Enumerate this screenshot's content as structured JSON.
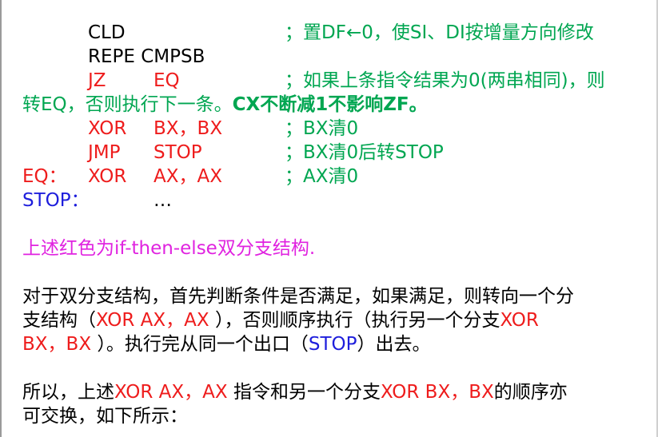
{
  "code": {
    "l1": {
      "instr": "CLD",
      "comment": "；置DF←0，使SI、DI按增量方向修改"
    },
    "l2": {
      "instr": "REPE  CMPSB"
    },
    "l3": {
      "op": "JZ",
      "arg": "EQ",
      "comment": "；如果上条指令结果为0(两串相同)，则"
    },
    "l4": {
      "text": "转EQ，否则执行下一条。",
      "bold_text": "CX不断减1不影响ZF。"
    },
    "l5": {
      "op": "XOR",
      "arg": "BX，BX",
      "comment": "；BX清0"
    },
    "l6": {
      "op": "JMP",
      "arg": "STOP",
      "comment": "；BX清0后转STOP"
    },
    "l7": {
      "label": "EQ：",
      "op": "XOR",
      "arg": "AX，AX",
      "comment": "；AX清0"
    },
    "l8": {
      "label": "STOP：",
      "arg": "…"
    }
  },
  "note": "上述红色为if-then-else双分支结构.",
  "para1": {
    "l1": "对于双分支结构，首先判断条件是否满足，如果满足，则转向一个分",
    "l2a": "支结构（",
    "l2b": "XOR  AX，AX ",
    "l2c": "），否则顺序执行（执行另一个分支",
    "l2d": "XOR",
    "l3a": "BX，BX ",
    "l3b": "）。执行完从同一个出口（",
    "l3c": "STOP",
    "l3d": "）出去。"
  },
  "para2": {
    "l1a": "所以，上述",
    "l1b": "XOR   AX，AX ",
    "l1c": "指令和另一个分支",
    "l1d": "XOR   BX，BX",
    "l1e": "的顺序亦",
    "l2": "可交换，如下所示："
  }
}
